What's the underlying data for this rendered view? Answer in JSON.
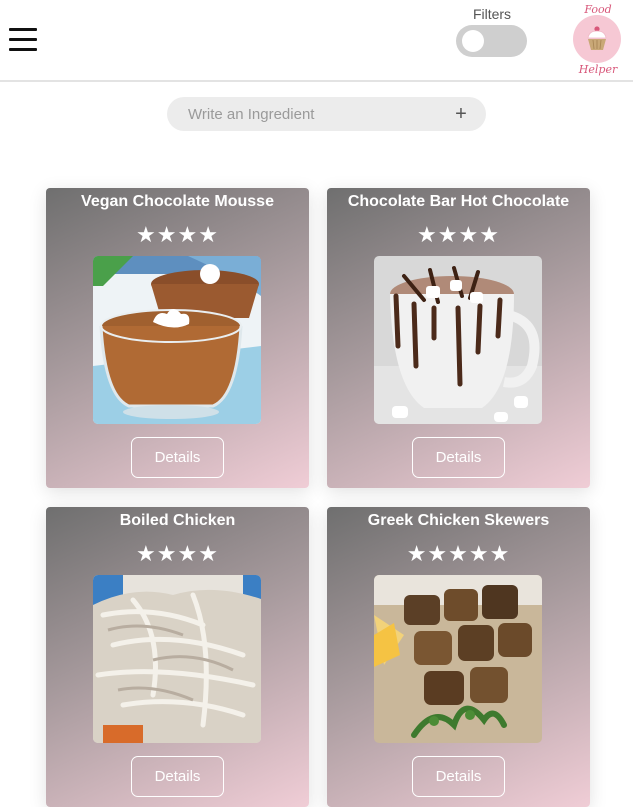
{
  "header": {
    "filters_label": "Filters",
    "filters_enabled": false,
    "logo_text_top": "Food",
    "logo_text_bottom": "Helper"
  },
  "search": {
    "placeholder": "Write an Ingredient",
    "value": "",
    "add_icon": "+"
  },
  "colors": {
    "logo_circle": "#f6c8d4",
    "logo_text": "#d8577a",
    "card_gradient_start": "#6f6f6f",
    "card_gradient_end": "#f0cdd6",
    "toggle_track": "#cfcfcf"
  },
  "recipes": [
    {
      "title": "Vegan Chocolate Mousse",
      "rating": 4,
      "stars": "★★★★",
      "details_label": "Details",
      "image": "chocolate-mousse-photo"
    },
    {
      "title": "Chocolate Bar Hot Chocolate",
      "rating": 4,
      "stars": "★★★★",
      "details_label": "Details",
      "image": "hot-chocolate-photo"
    },
    {
      "title": "Boiled Chicken",
      "rating": 4,
      "stars": "★★★★",
      "details_label": "Details",
      "image": "shredded-chicken-photo"
    },
    {
      "title": "Greek Chicken Skewers",
      "rating": 5,
      "stars": "★★★★★",
      "details_label": "Details",
      "image": "chicken-skewers-photo"
    }
  ]
}
